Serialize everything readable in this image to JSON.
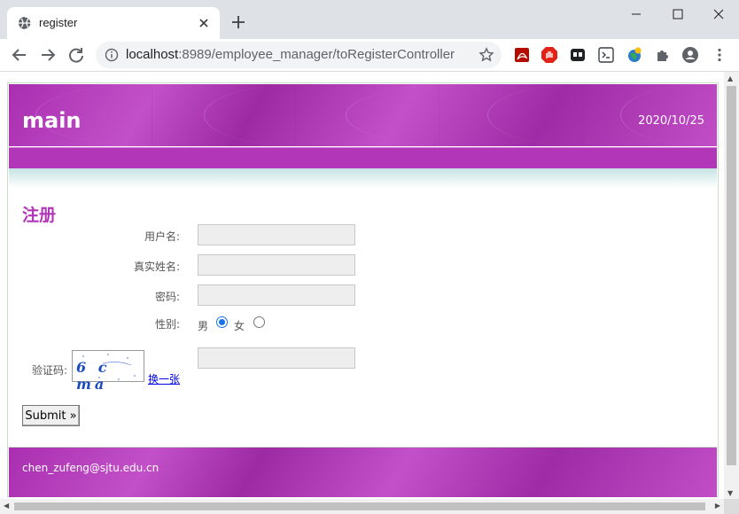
{
  "browser": {
    "tab_title": "register",
    "url_host": "localhost",
    "url_path": ":8989/employee_manager/toRegisterController"
  },
  "header": {
    "logo": "main",
    "date": "2020/10/25"
  },
  "form": {
    "heading": "注册",
    "username_label": "用户名:",
    "realname_label": "真实姓名:",
    "password_label": "密码:",
    "gender_label": "性别:",
    "gender_male": "男",
    "gender_female": "女",
    "gender_selected": "男",
    "captcha_label": "验证码:",
    "captcha_text": "6 c ma",
    "refresh_link": "换一张",
    "submit_label": "Submit »",
    "username_value": "",
    "realname_value": "",
    "password_value": "",
    "captcha_value": ""
  },
  "footer": {
    "email": "chen_zufeng@sjtu.edu.cn"
  },
  "colors": {
    "accent": "#b236b8",
    "header_purple": "#a92fb0",
    "field_bg": "#eeeeee"
  },
  "icons": {
    "tab": "globe-icon",
    "back": "back-arrow-icon",
    "forward": "forward-arrow-icon",
    "reload": "reload-icon",
    "info": "info-icon",
    "star": "bookmark-star-icon",
    "extensions": [
      "pdf-extension-icon",
      "adblock-icon",
      "media-extension-icon",
      "terminal-extension-icon",
      "globe-extension-icon",
      "puzzle-icon",
      "profile-icon",
      "menu-dots-icon"
    ]
  }
}
